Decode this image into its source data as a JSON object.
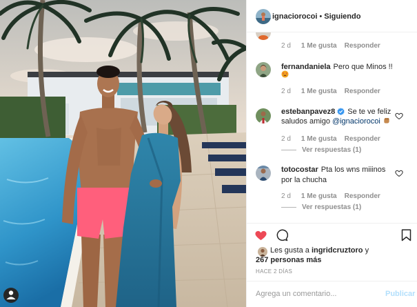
{
  "header": {
    "avatar_icon": "user-avatar",
    "username": "ignaciorocoi",
    "separator": "•",
    "follow_status": "Siguiendo"
  },
  "photo": {
    "tag_icon": "user-tag-icon"
  },
  "partial_comment": {
    "age": "2 d",
    "likes": "1 Me gusta",
    "reply": "Responder"
  },
  "comments": [
    {
      "username": "fernandaniela",
      "lines": [
        "Pero que Minos !!"
      ],
      "emoji": "smiling-face-with-heart-eyes-emoji",
      "age": "2 d",
      "likes": "1 Me gusta",
      "reply": "Responder"
    },
    {
      "username": "estebanpavez8",
      "verified": true,
      "lines": [
        "Se te ve feliz",
        "saludos amigo"
      ],
      "mention": "@ignaciorocoi",
      "emoji": "fist-emoji",
      "age": "2 d",
      "likes": "1 Me gusta",
      "reply": "Responder",
      "view_replies": "Ver respuestas (1)"
    },
    {
      "username": "totocostar",
      "lines": [
        "Pta los wns miiinos",
        "por la chucha"
      ],
      "age": "2 d",
      "likes": "1 Me gusta",
      "reply": "Responder",
      "view_replies": "Ver respuestas (1)"
    }
  ],
  "actions": {
    "like_icon": "heart-filled-icon",
    "comment_icon": "comment-bubble-icon",
    "save_icon": "bookmark-icon"
  },
  "likes": {
    "prefix": "Les gusta a",
    "user": "ingridcruztoro",
    "conjunction": "y",
    "others": "267 personas más"
  },
  "timestamp": "HACE 2 DÍAS",
  "comment_box": {
    "placeholder": "Agrega un comentario...",
    "submit_label": "Publicar"
  },
  "colors": {
    "like_red": "#ed4956",
    "mention_blue": "#003569",
    "publish_blue": "#b2dffc",
    "meta_gray": "#8e8e8e",
    "verified_blue": "#3897f0"
  }
}
